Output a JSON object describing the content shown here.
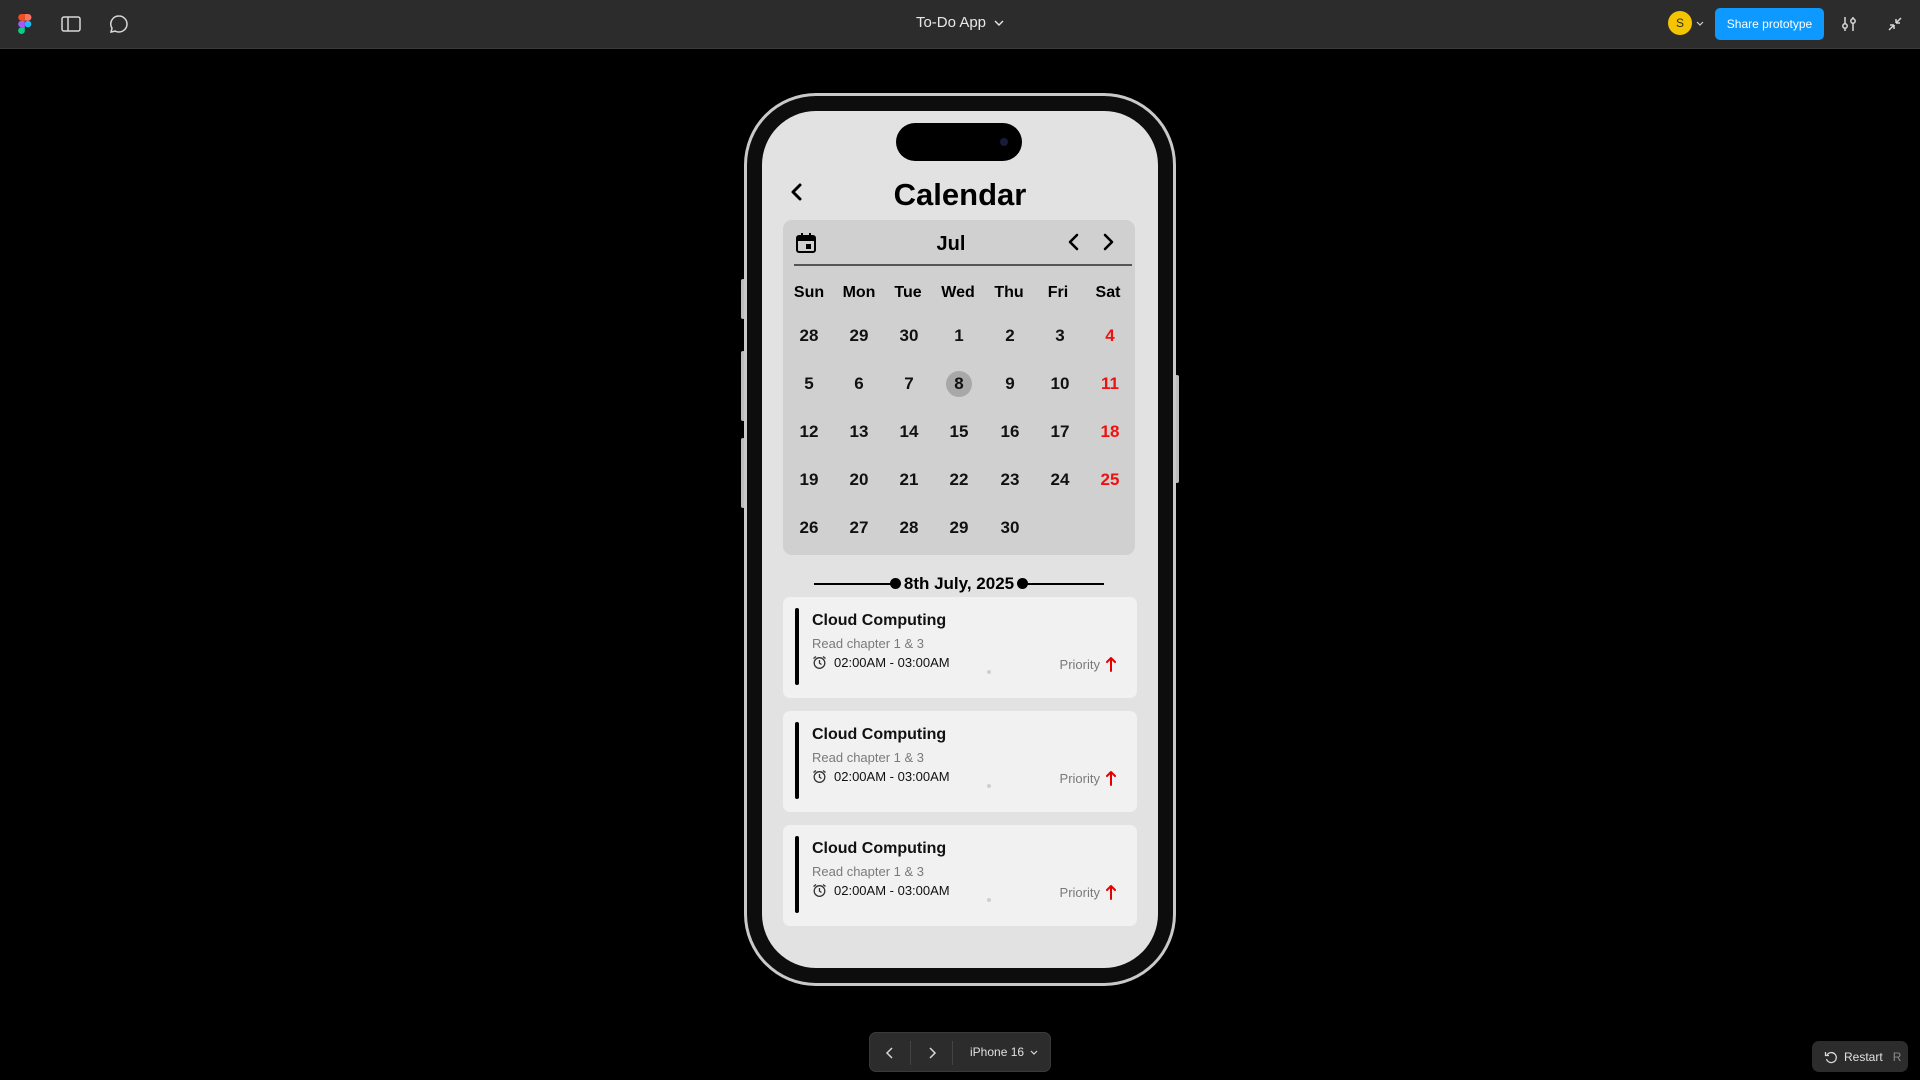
{
  "toolbar": {
    "file_title": "To-Do App",
    "avatar_initial": "S",
    "share_label": "Share prototype"
  },
  "screen": {
    "title": "Calendar",
    "calendar": {
      "month": "Jul",
      "weekdays": [
        "Sun",
        "Mon",
        "Tue",
        "Wed",
        "Thu",
        "Fri",
        "Sat"
      ],
      "weeks": [
        [
          "28",
          "29",
          "30",
          "1",
          "2",
          "3",
          "4"
        ],
        [
          "5",
          "6",
          "7",
          "8",
          "9",
          "10",
          "11"
        ],
        [
          "12",
          "13",
          "14",
          "15",
          "16",
          "17",
          "18"
        ],
        [
          "19",
          "20",
          "21",
          "22",
          "23",
          "24",
          "25"
        ],
        [
          "26",
          "27",
          "28",
          "29",
          "30",
          "",
          ""
        ]
      ],
      "selected_day": "8",
      "weekend_color": "#ee1111"
    },
    "selected_date_label": "8th July, 2025",
    "tasks": [
      {
        "title": "Cloud Computing",
        "subtitle": "Read chapter 1 & 3",
        "time": "02:00AM - 03:00AM",
        "priority_label": "Priority"
      },
      {
        "title": "Cloud Computing",
        "subtitle": "Read chapter 1 & 3",
        "time": "02:00AM - 03:00AM",
        "priority_label": "Priority"
      },
      {
        "title": "Cloud Computing",
        "subtitle": "Read chapter 1 & 3",
        "time": "02:00AM - 03:00AM",
        "priority_label": "Priority"
      }
    ],
    "priority_color": "#e60000"
  },
  "bottom": {
    "device_label": "iPhone 16",
    "restart_label": "Restart",
    "restart_shortcut": "R"
  },
  "colors": {
    "share_button": "#0d99ff",
    "avatar": "#f5c400"
  }
}
